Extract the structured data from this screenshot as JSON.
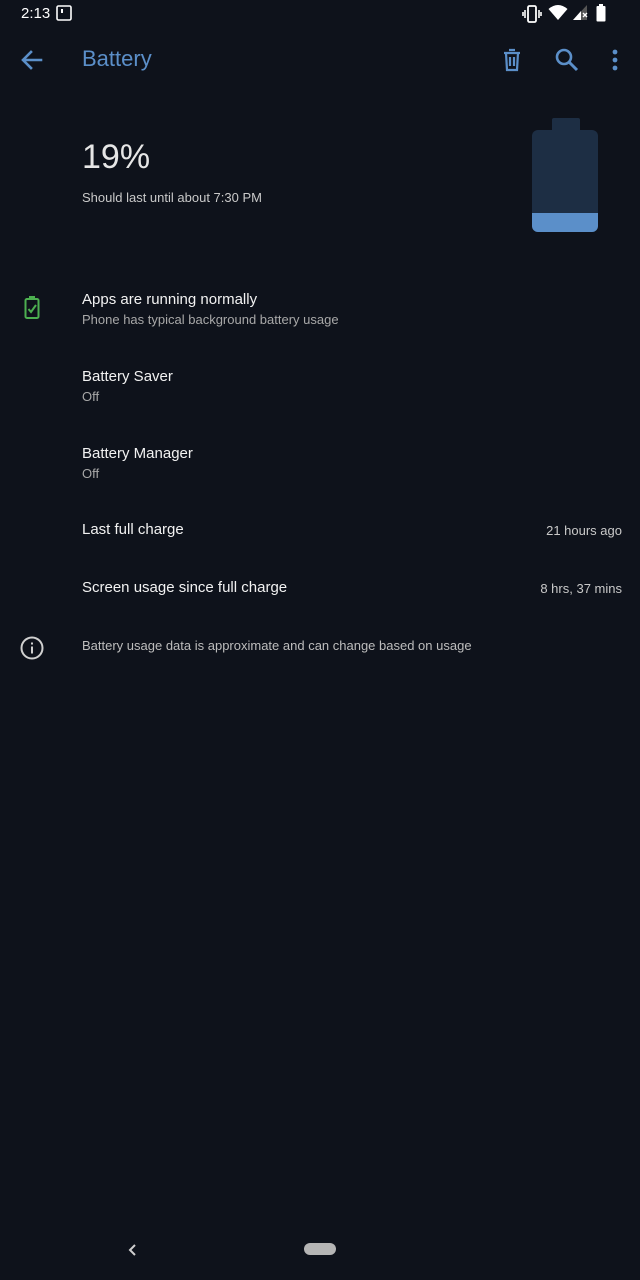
{
  "status_bar": {
    "time": "2:13",
    "icons": [
      "notification-icon",
      "vibrate-icon",
      "wifi-icon",
      "signal-icon",
      "battery-icon"
    ]
  },
  "app_bar": {
    "title": "Battery",
    "back_icon": "arrow-left-icon",
    "actions": [
      "delete-icon",
      "search-icon",
      "more-vert-icon"
    ]
  },
  "header": {
    "percent": "19%",
    "estimate": "Should last until about 7:30 PM",
    "battery_level_fraction": 0.19
  },
  "items": {
    "apps_status": {
      "title": "Apps are running normally",
      "subtitle": "Phone has typical background battery usage",
      "icon": "battery-check-icon"
    },
    "battery_saver": {
      "title": "Battery Saver",
      "subtitle": "Off"
    },
    "battery_manager": {
      "title": "Battery Manager",
      "subtitle": "Off"
    },
    "last_full_charge": {
      "title": "Last full charge",
      "value": "21 hours ago"
    },
    "screen_usage": {
      "title": "Screen usage since full charge",
      "value": "8 hrs, 37 mins"
    },
    "info": {
      "text": "Battery usage data is approximate and can change based on usage",
      "icon": "info-icon"
    }
  },
  "colors": {
    "background": "#0e121b",
    "accent": "#5b8fc9",
    "battery_empty": "#1d2e44",
    "ok_green": "#4caf50"
  }
}
